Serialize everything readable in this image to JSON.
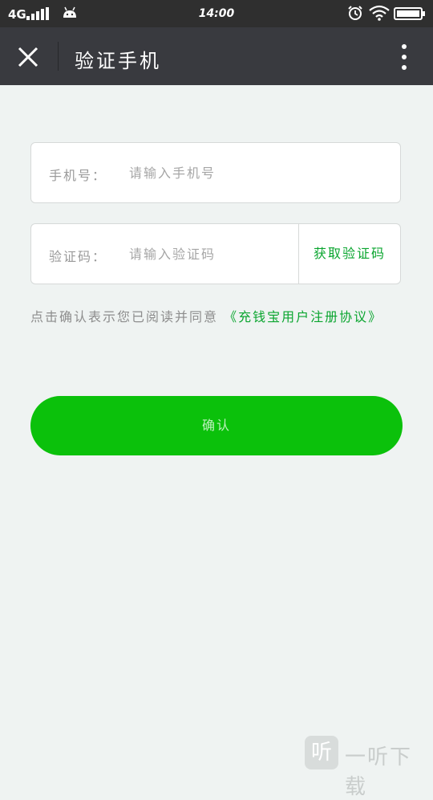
{
  "status_bar": {
    "carrier": "4G",
    "time": "14:00",
    "icons": [
      "signal-icon",
      "android-icon",
      "alarm-icon",
      "wifi-icon",
      "battery-icon"
    ]
  },
  "header": {
    "title": "验证手机",
    "close_icon": "close-icon",
    "menu_icon": "more-vertical-icon"
  },
  "form": {
    "phone": {
      "label": "手机号：",
      "placeholder": "请输入手机号",
      "value": ""
    },
    "code": {
      "label": "验证码：",
      "placeholder": "请输入验证码",
      "value": "",
      "get_code_label": "获取验证码"
    },
    "agreement_text": "点击确认表示您已阅读并同意",
    "agreement_link": "《充钱宝用户注册协议》",
    "confirm_label": "确认"
  },
  "watermark": {
    "logo_char": "听",
    "text": "一听下载"
  },
  "colors": {
    "status_bar_bg": "#2f2f2f",
    "header_bg": "#393a3f",
    "page_bg": "#eff3f2",
    "accent_green": "#0aa52f",
    "button_green": "#0bc10b"
  }
}
